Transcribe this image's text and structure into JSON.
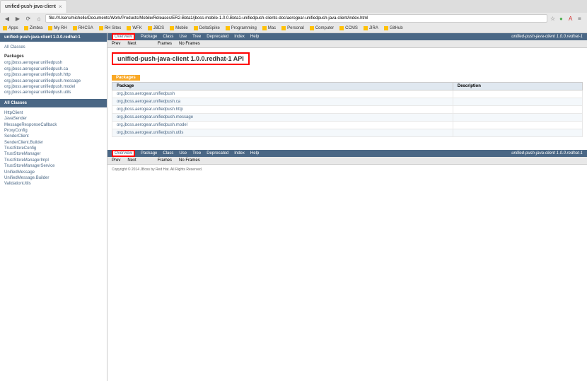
{
  "browser": {
    "tab_title": "unified-push-java-client",
    "url": "file:///Users/michelle/Documents/Work/Products/Mobile/Releases/ER2-Beta1/jboss-mobile-1.0.0.Beta1-unifiedpush-clients-doc/aerogear-unifiedpush-java-client/index.html"
  },
  "bookmarks": [
    "Apps",
    "Zimbra",
    "My RH",
    "RHCSA",
    "RH Sites",
    "WFK",
    "JBDS",
    "Mobile",
    "DeltaSpike",
    "Programming",
    "Mac",
    "Personal",
    "Computer",
    "CCMS",
    "JIRA",
    "GitHub"
  ],
  "sidebar": {
    "header": "unified-push-java-client 1.0.0.redhat-1",
    "all_classes": "All Classes",
    "packages_title": "Packages",
    "packages": [
      "org.jboss.aerogear.unifiedpush",
      "org.jboss.aerogear.unifiedpush.ca",
      "org.jboss.aerogear.unifiedpush.http",
      "org.jboss.aerogear.unifiedpush.message",
      "org.jboss.aerogear.unifiedpush.model",
      "org.jboss.aerogear.unifiedpush.utils"
    ],
    "all_classes_header": "All Classes",
    "classes": [
      "HttpClient",
      "JavaSender",
      "MessageResponseCallback",
      "ProxyConfig",
      "SenderClient",
      "SenderClient.Builder",
      "TrustStoreConfig",
      "TrustStoreManager",
      "TrustStoreManagerImpl",
      "TrustStoreManagerService",
      "UnifiedMessage",
      "UnifiedMessage.Builder",
      "ValidationUtils"
    ]
  },
  "main": {
    "nav": [
      "Overview",
      "Package",
      "Class",
      "Use",
      "Tree",
      "Deprecated",
      "Index",
      "Help"
    ],
    "nav_right": "unified-push-java-client 1.0.0.redhat-1",
    "sub_nav": {
      "prev": "Prev",
      "next": "Next",
      "frames": "Frames",
      "no_frames": "No Frames"
    },
    "title": "unified-push-java-client 1.0.0.redhat-1 API",
    "packages_tab": "Packages",
    "table_headers": {
      "package": "Package",
      "description": "Description"
    },
    "table_rows": [
      "org.jboss.aerogear.unifiedpush",
      "org.jboss.aerogear.unifiedpush.ca",
      "org.jboss.aerogear.unifiedpush.http",
      "org.jboss.aerogear.unifiedpush.message",
      "org.jboss.aerogear.unifiedpush.model",
      "org.jboss.aerogear.unifiedpush.utils"
    ],
    "footer": "Copyright © 2014 JBoss by Red Hat. All Rights Reserved."
  }
}
